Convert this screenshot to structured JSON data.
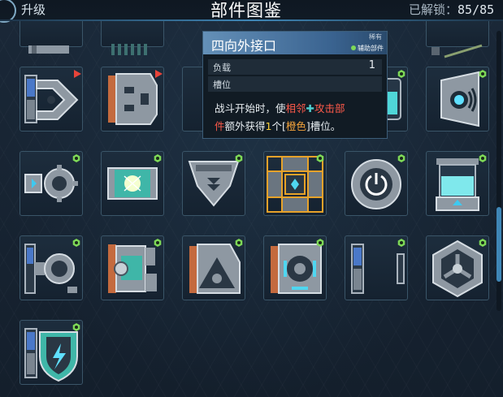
{
  "header": {
    "back_label": "升级",
    "title": "部件图鉴",
    "unlock_label": "已解锁：",
    "unlock_count": "85/85"
  },
  "tooltip": {
    "title": "四向外接口",
    "rarity": "稀有",
    "type": "辅助部件",
    "stats": [
      {
        "key": "负载",
        "value": "1"
      },
      {
        "key": "槽位",
        "value": ""
      }
    ],
    "desc": {
      "p1": "战斗开始时，使",
      "adj": "相邻",
      "plus": "✚",
      "atk": "攻击部",
      "atk2": "件",
      "p2": "额外获得",
      "num": "1",
      "p3": "个[",
      "color": "橙色",
      "p4": "]槽位。"
    }
  },
  "colors": {
    "accent": "#3f86b6",
    "badge_green": "#7ed957",
    "new_arrow": "#e8443a",
    "highlight_orange": "#e6a22a"
  },
  "parts": [
    {
      "icon": "scissor-clamp-part-icon",
      "badge": "new-arrow"
    },
    {
      "icon": "gripper-block-part-icon",
      "badge": "new-arrow"
    },
    {
      "icon": "gear-connector-part-icon",
      "badge": "green-hex"
    },
    {
      "icon": "energy-cell-part-icon",
      "badge": "green-hex"
    },
    {
      "icon": "shield-emblem-part-icon",
      "badge": "green-hex"
    },
    {
      "icon": "four-way-connector-part-icon",
      "badge": "green-hex",
      "selected": true
    },
    {
      "icon": "power-ring-part-icon",
      "badge": "green-hex"
    },
    {
      "icon": "coolant-tank-part-icon",
      "badge": "green-hex"
    },
    {
      "icon": "speaker-core-part-icon",
      "badge": "green-hex"
    },
    {
      "icon": "valve-pipe-part-icon",
      "badge": "green-hex"
    },
    {
      "icon": "gauge-piston-part-icon",
      "badge": "green-hex"
    },
    {
      "icon": "triangle-eye-part-icon",
      "badge": "green-hex"
    },
    {
      "icon": "target-frame-part-icon",
      "badge": "green-hex"
    },
    {
      "icon": "side-plates-part-icon",
      "badge": "green-hex"
    },
    {
      "icon": "hex-fan-part-icon",
      "badge": "green-hex"
    },
    {
      "icon": "lightning-shield-part-icon",
      "badge": "green-hex"
    }
  ]
}
